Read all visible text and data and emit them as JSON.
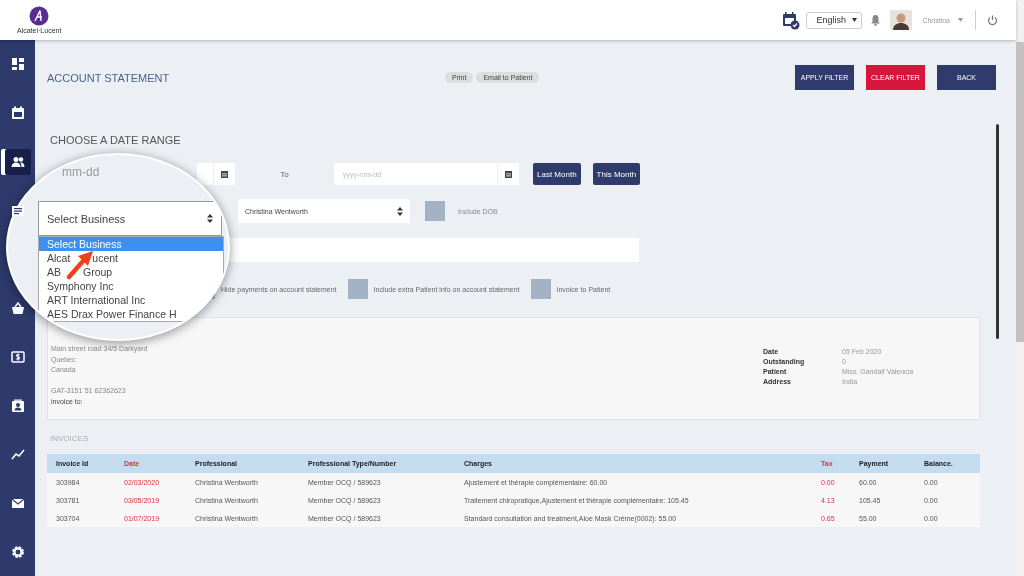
{
  "header": {
    "logo_text": "Alcatel·Lucent",
    "language": "English",
    "user": "Christina"
  },
  "sidebar": {
    "items": [
      {
        "kind": "dashboard",
        "selected": false
      },
      {
        "kind": "calendar",
        "selected": false
      },
      {
        "kind": "people",
        "selected": true
      },
      {
        "kind": "document",
        "selected": false
      },
      {
        "kind": "basket",
        "selected": false
      },
      {
        "kind": "dollar",
        "selected": false
      },
      {
        "kind": "contact",
        "selected": false
      },
      {
        "kind": "chart",
        "selected": false
      },
      {
        "kind": "mail",
        "selected": false
      },
      {
        "kind": "settings",
        "selected": false
      }
    ]
  },
  "page": {
    "title": "ACCOUNT STATEMENT",
    "pills": [
      "Print",
      "Email to Patient"
    ],
    "buttons": [
      {
        "label": "APPLY FILTER",
        "kind": "primary"
      },
      {
        "label": "CLEAR FILTER",
        "kind": "danger"
      },
      {
        "label": "BACK",
        "kind": "primary"
      }
    ]
  },
  "filters": {
    "heading": "CHOOSE A DATE RANGE",
    "to_label": "To",
    "to_placeholder": "yyyy-mm-dd",
    "quick_buttons": [
      "Last Month",
      "This Month"
    ],
    "patient": "Christina Wentworth",
    "include_dob": {
      "label": "Include DOB",
      "checked": false
    },
    "options": [
      {
        "label": "Hide payments on account statement",
        "checked": false
      },
      {
        "label": "Include extra Patient info on account statement",
        "checked": false
      },
      {
        "label": "Invoice to Patient",
        "checked": false
      }
    ]
  },
  "magnifier": {
    "from_placeholder": "mm-dd",
    "business_select": "Select Business",
    "business_options": [
      {
        "parts": [
          "Select Business"
        ],
        "selected": true
      },
      {
        "parts": [
          "Alcat",
          "ucent"
        ],
        "selected": false
      },
      {
        "parts": [
          "AB",
          "Group"
        ],
        "selected": false
      },
      {
        "parts": [
          "Symphony Inc"
        ],
        "selected": false
      },
      {
        "parts": [
          "ART International Inc"
        ],
        "selected": false
      },
      {
        "parts": [
          "AES Drax Power Finance H"
        ],
        "selected": false
      }
    ]
  },
  "card": {
    "address_lines": [
      "Main street road 34/5 Darkyard",
      "Quebec",
      "Canada"
    ],
    "tax_id": "GAT-3151`51 62362623",
    "invoice_to": "invoice to:",
    "details": [
      {
        "label": "Date",
        "value": "05 Feb 2020"
      },
      {
        "label": "Outstanding",
        "value": "0"
      },
      {
        "label": "Patient",
        "value": "Miss. Gandalf Valencia"
      },
      {
        "label": "Address",
        "value": "India"
      }
    ]
  },
  "invoices": {
    "heading": "INVOICES",
    "columns": [
      {
        "label": "Invoice Id",
        "highlight": false
      },
      {
        "label": "Date",
        "highlight": true
      },
      {
        "label": "Professional",
        "highlight": false
      },
      {
        "label": "Professional Type/Number",
        "highlight": false
      },
      {
        "label": "Charges",
        "highlight": false
      },
      {
        "label": "Tax",
        "highlight": true
      },
      {
        "label": "Payment",
        "highlight": false
      },
      {
        "label": "Balance.",
        "highlight": false
      }
    ],
    "rows": [
      [
        "303984",
        "02/03/2020",
        "Christina Wentworth",
        "Member OCQ / 589623",
        "Ajustement et thérapie complémentaire: 60.00",
        "0.00",
        "60.00",
        "0.00"
      ],
      [
        "303781",
        "03/05/2019",
        "Christina Wentworth",
        "Member OCQ / 589623",
        "Traitement chiropratique,Ajustement et thérapie complémentaire: 105.45",
        "4.13",
        "105.45",
        "0.00"
      ],
      [
        "303704",
        "01/07/2019",
        "Christina Wentworth",
        "Member OCQ / 589623",
        "Standard consultation and treatment,Aloe Mask Crème(0002): 55.00",
        "0.65",
        "55.00",
        "0.00"
      ]
    ]
  }
}
